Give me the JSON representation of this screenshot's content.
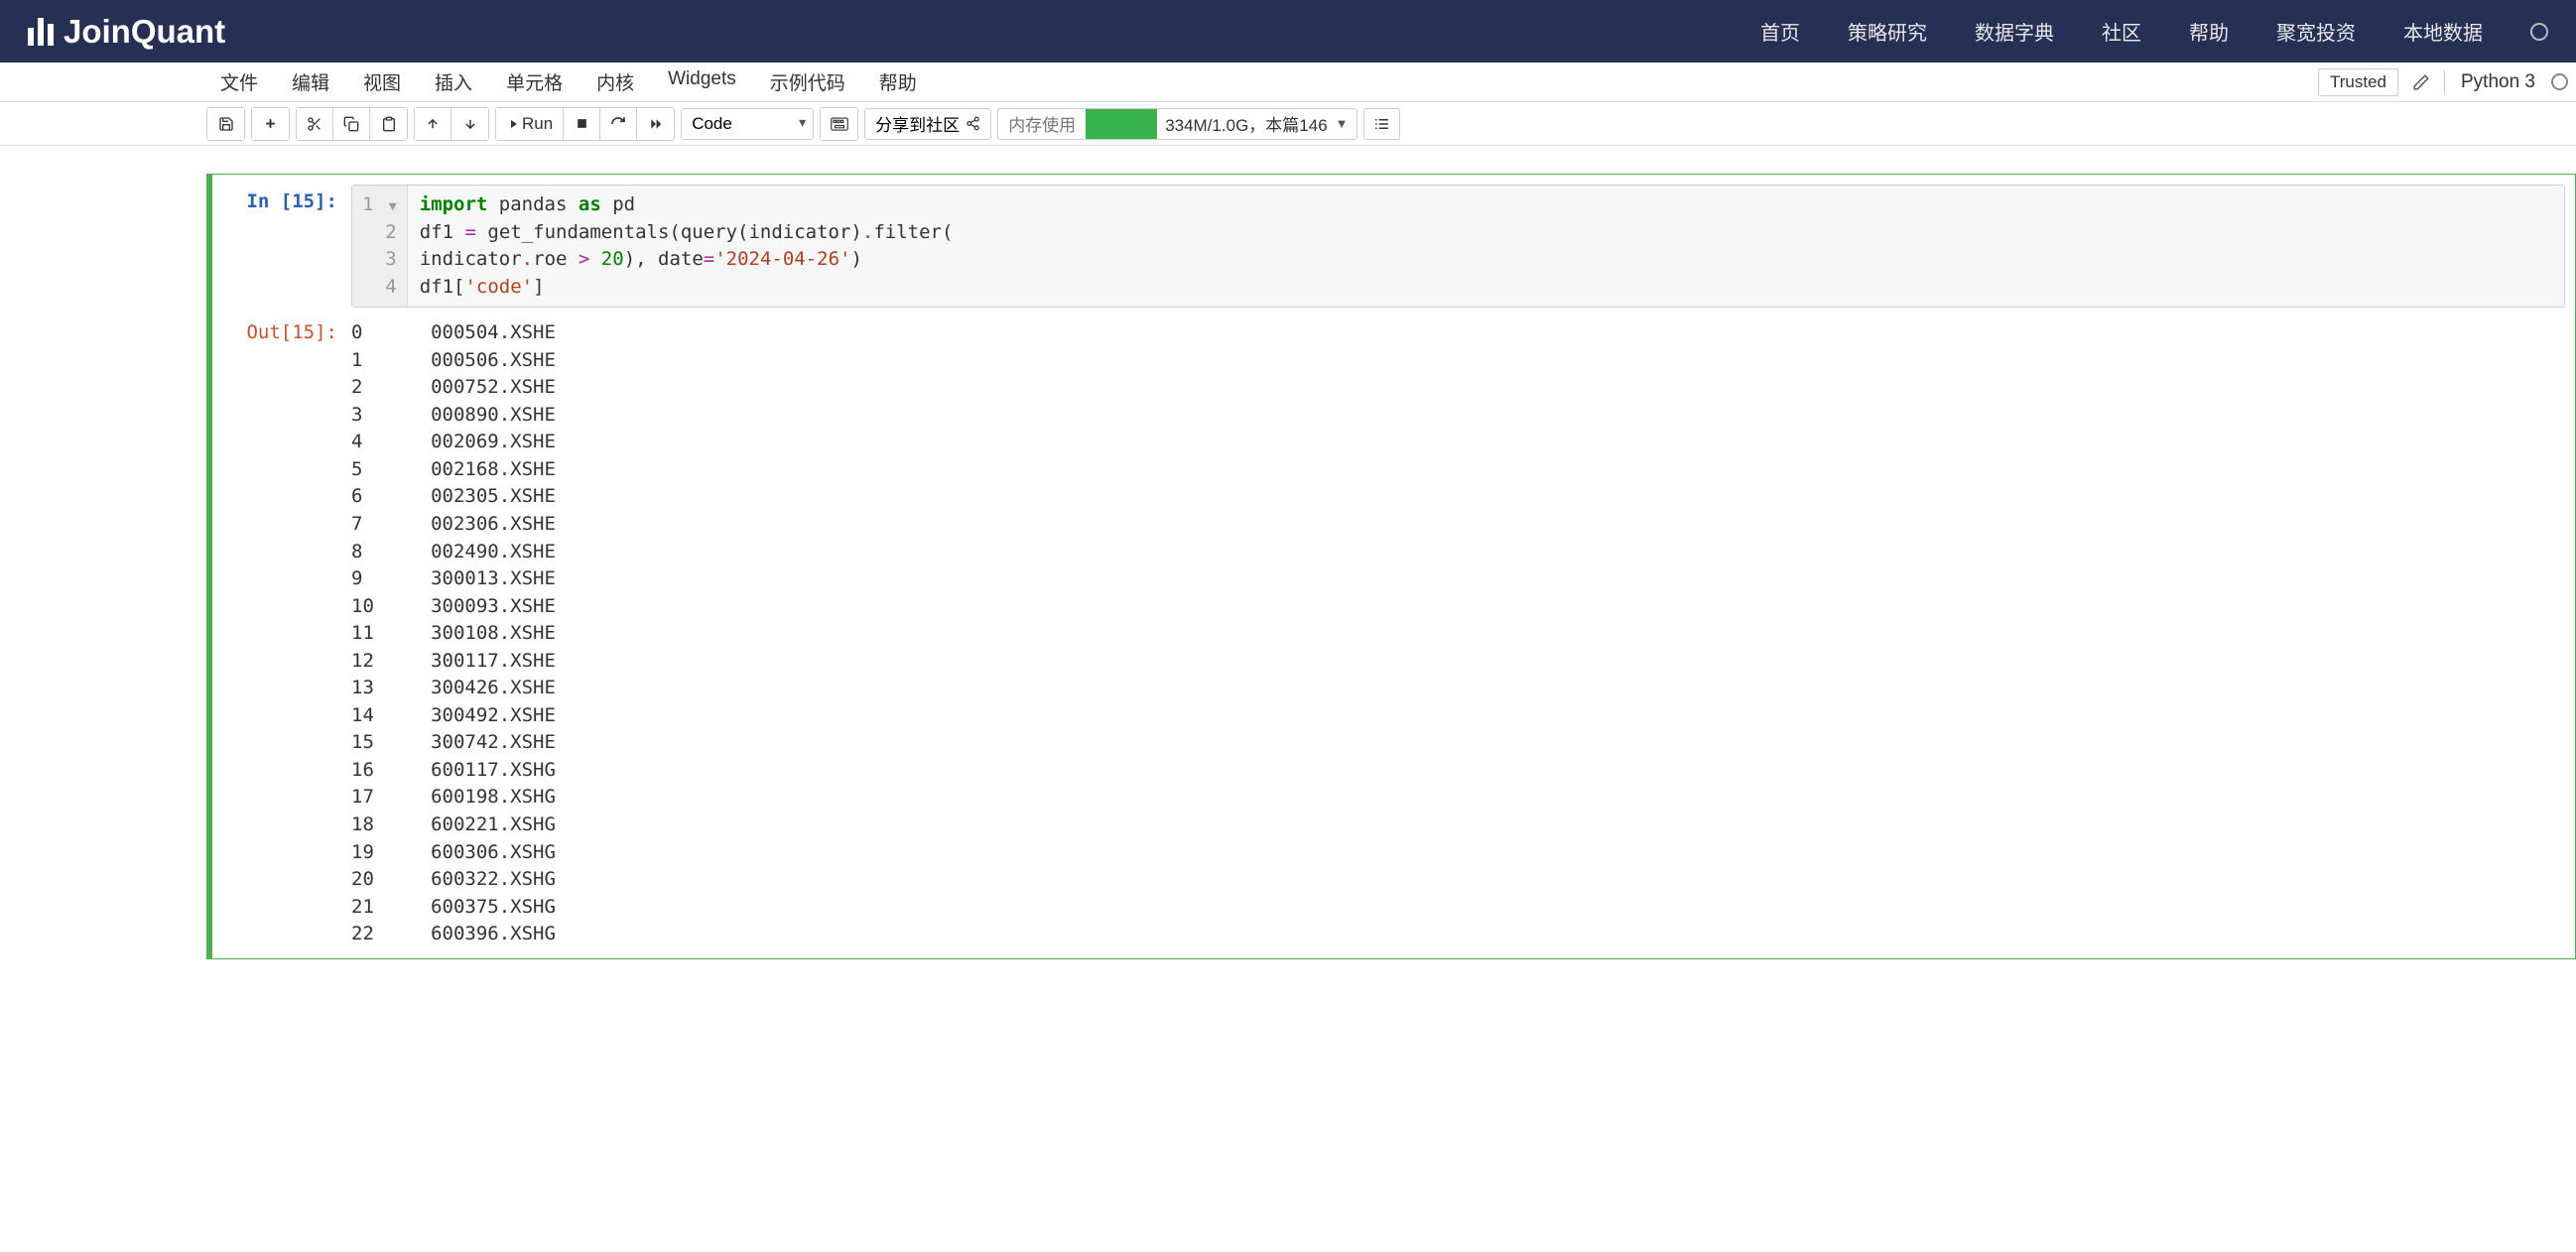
{
  "brand": "JoinQuant",
  "topnav": [
    "首页",
    "策略研究",
    "数据字典",
    "社区",
    "帮助",
    "聚宽投资",
    "本地数据"
  ],
  "menubar": [
    "文件",
    "编辑",
    "视图",
    "插入",
    "单元格",
    "内核",
    "Widgets",
    "示例代码",
    "帮助"
  ],
  "trusted": "Trusted",
  "kernel": "Python 3",
  "run_label": "Run",
  "celltype": "Code",
  "share_label": "分享到社区",
  "mem_label": "内存使用",
  "mem_text": "334M/1.0G，本篇146",
  "cell": {
    "in_prompt": "In [15]:",
    "out_prompt": "Out[15]:",
    "gutter": [
      "1",
      "2",
      "3",
      "4"
    ],
    "code_tokens": [
      [
        {
          "c": "kw",
          "t": "import"
        },
        {
          "c": "",
          "t": " pandas "
        },
        {
          "c": "kw",
          "t": "as"
        },
        {
          "c": "",
          "t": " pd"
        }
      ],
      [
        {
          "c": "",
          "t": "df1 "
        },
        {
          "c": "op",
          "t": "="
        },
        {
          "c": "",
          "t": " get_fundamentals(query(indicator)"
        },
        {
          "c": "op",
          "t": "."
        },
        {
          "c": "",
          "t": "filter("
        }
      ],
      [
        {
          "c": "",
          "t": "indicator"
        },
        {
          "c": "op",
          "t": "."
        },
        {
          "c": "",
          "t": "roe "
        },
        {
          "c": "op",
          "t": ">"
        },
        {
          "c": "",
          "t": " "
        },
        {
          "c": "num",
          "t": "20"
        },
        {
          "c": "",
          "t": "), date"
        },
        {
          "c": "op",
          "t": "="
        },
        {
          "c": "str",
          "t": "'2024-04-26'"
        },
        {
          "c": "",
          "t": ")"
        }
      ],
      [
        {
          "c": "",
          "t": "df1["
        },
        {
          "c": "str",
          "t": "'code'"
        },
        {
          "c": "",
          "t": "]"
        }
      ]
    ],
    "output_rows": [
      {
        "idx": "0",
        "val": "000504.XSHE"
      },
      {
        "idx": "1",
        "val": "000506.XSHE"
      },
      {
        "idx": "2",
        "val": "000752.XSHE"
      },
      {
        "idx": "3",
        "val": "000890.XSHE"
      },
      {
        "idx": "4",
        "val": "002069.XSHE"
      },
      {
        "idx": "5",
        "val": "002168.XSHE"
      },
      {
        "idx": "6",
        "val": "002305.XSHE"
      },
      {
        "idx": "7",
        "val": "002306.XSHE"
      },
      {
        "idx": "8",
        "val": "002490.XSHE"
      },
      {
        "idx": "9",
        "val": "300013.XSHE"
      },
      {
        "idx": "10",
        "val": "300093.XSHE"
      },
      {
        "idx": "11",
        "val": "300108.XSHE"
      },
      {
        "idx": "12",
        "val": "300117.XSHE"
      },
      {
        "idx": "13",
        "val": "300426.XSHE"
      },
      {
        "idx": "14",
        "val": "300492.XSHE"
      },
      {
        "idx": "15",
        "val": "300742.XSHE"
      },
      {
        "idx": "16",
        "val": "600117.XSHG"
      },
      {
        "idx": "17",
        "val": "600198.XSHG"
      },
      {
        "idx": "18",
        "val": "600221.XSHG"
      },
      {
        "idx": "19",
        "val": "600306.XSHG"
      },
      {
        "idx": "20",
        "val": "600322.XSHG"
      },
      {
        "idx": "21",
        "val": "600375.XSHG"
      },
      {
        "idx": "22",
        "val": "600396.XSHG"
      }
    ]
  }
}
